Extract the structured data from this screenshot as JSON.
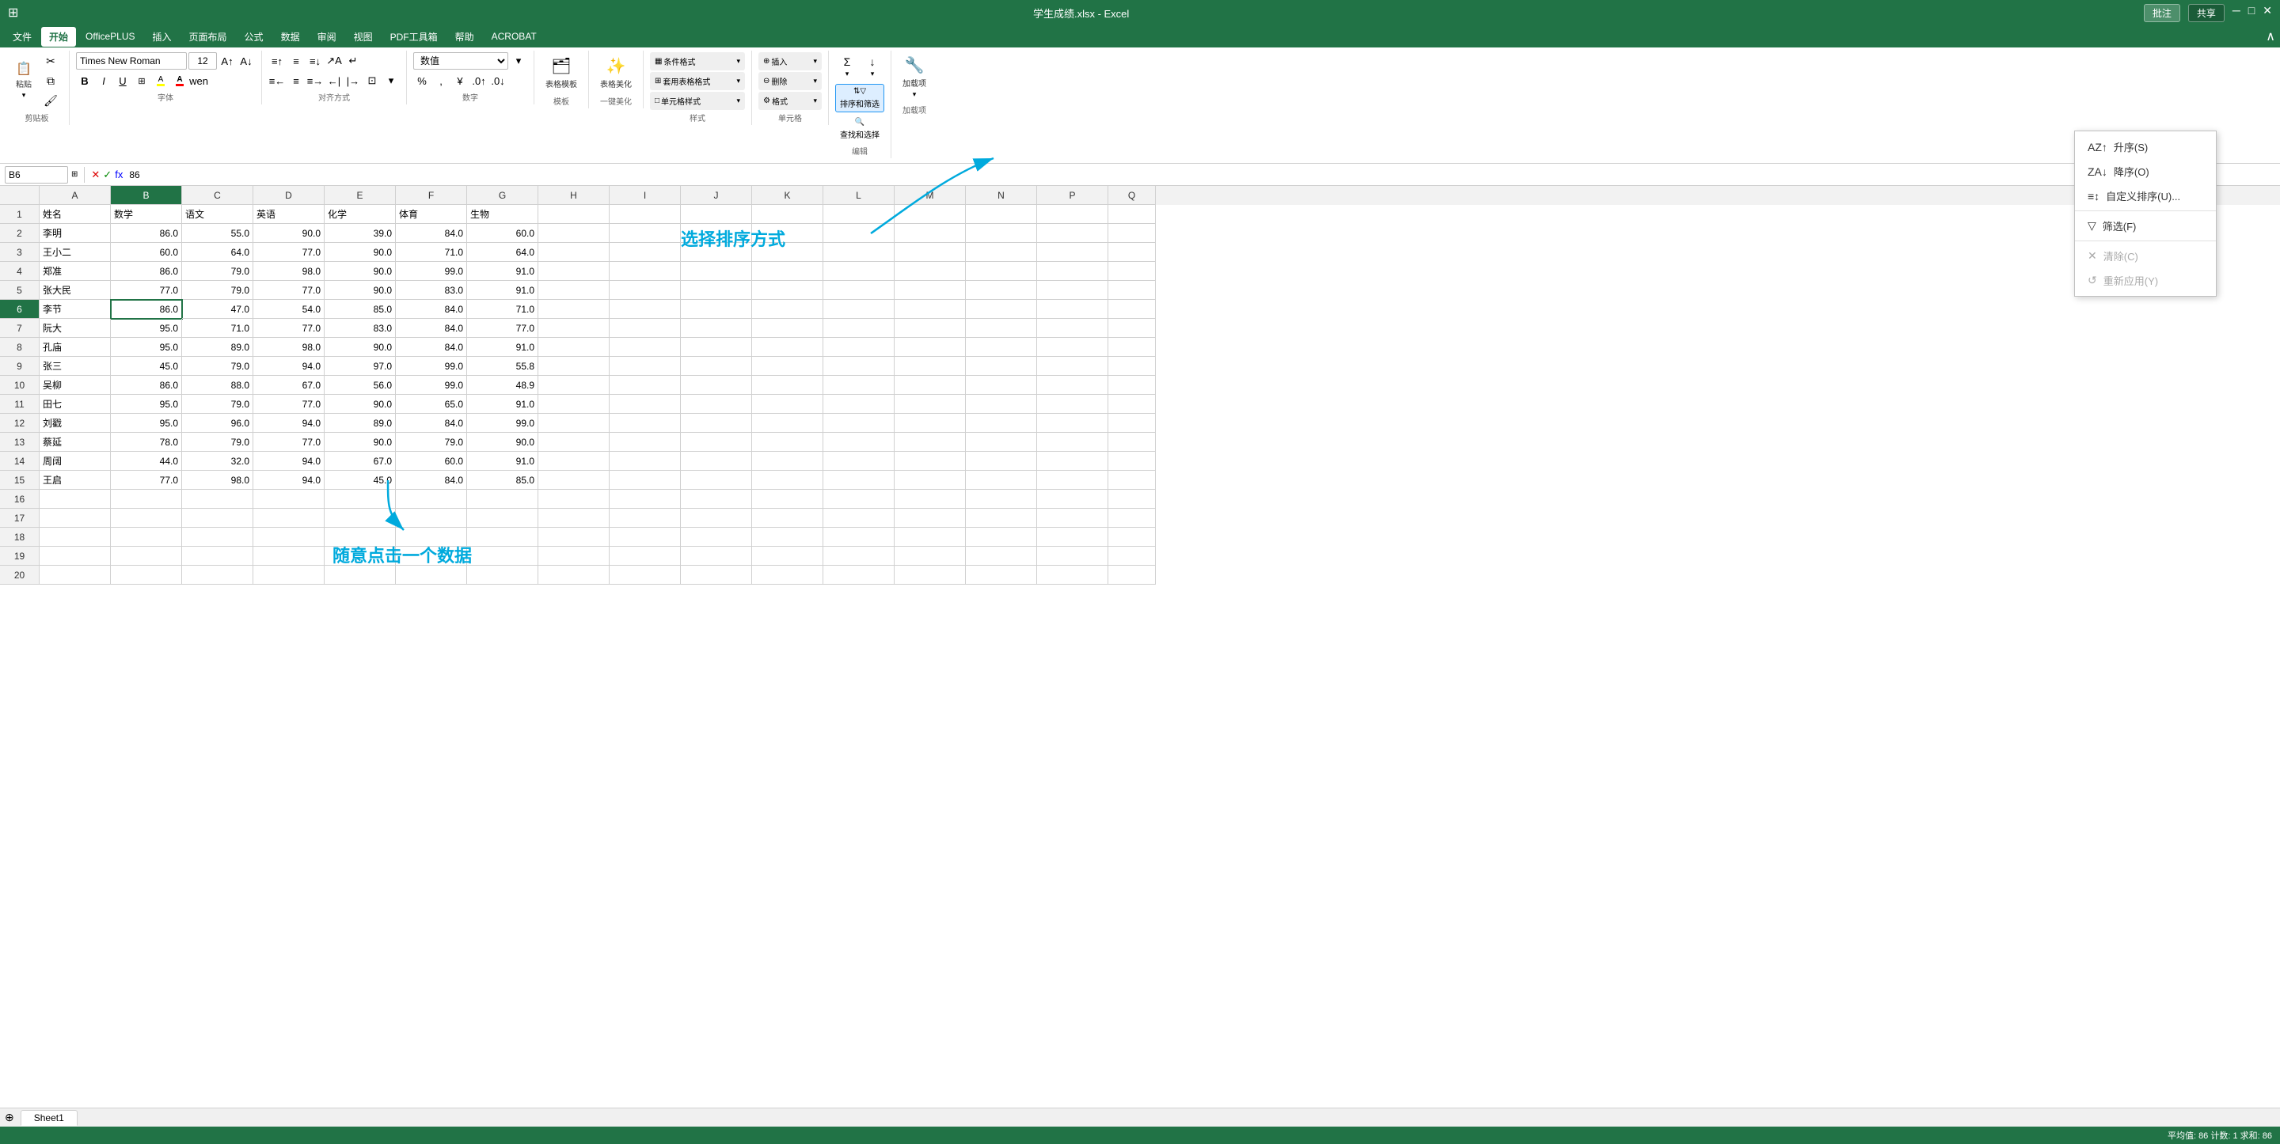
{
  "titleBar": {
    "filename": "学生成绩.xlsx - Excel",
    "commentBtn": "批注",
    "shareBtn": "共享"
  },
  "menuBar": {
    "items": [
      "文件",
      "开始",
      "OfficePLUS",
      "插入",
      "页面布局",
      "公式",
      "数据",
      "审阅",
      "视图",
      "PDF工具箱",
      "帮助",
      "ACROBAT"
    ]
  },
  "ribbon": {
    "groups": {
      "clipboard": {
        "label": "剪贴板",
        "paste": "粘贴",
        "cut": "✂",
        "copy": "⧉",
        "formatPainter": "🖌"
      },
      "font": {
        "label": "字体",
        "fontName": "Times New Roman",
        "fontSize": "12",
        "bold": "B",
        "italic": "I",
        "underline": "U",
        "border": "⊞",
        "fillColor": "🎨",
        "fontColor": "A"
      },
      "alignment": {
        "label": "对齐方式",
        "wrap": "↵"
      },
      "number": {
        "label": "数字",
        "format": "数值"
      },
      "template": {
        "label": "模板",
        "tableTemplate": "表格模板"
      },
      "beauty": {
        "label": "一键美化",
        "tableBeauty": "表格美化"
      },
      "style": {
        "label": "样式",
        "condFormat": "条件格式",
        "tableFormat": "套用表格格式",
        "cellStyle": "单元格样式"
      },
      "cells": {
        "label": "单元格",
        "insert": "插入",
        "delete": "删除",
        "format": "格式"
      },
      "editing": {
        "label": "编辑",
        "sum": "Σ",
        "sortFilter": "排序和筛选",
        "findSelect": "查找和选择"
      },
      "addins": {
        "label": "加载项",
        "addins": "加载项"
      }
    }
  },
  "formulaBar": {
    "cellRef": "B6",
    "value": "86"
  },
  "spreadsheet": {
    "columns": [
      "A",
      "B",
      "C",
      "D",
      "E",
      "F",
      "G",
      "H",
      "I",
      "J",
      "K",
      "L",
      "M",
      "N",
      "P",
      "Q"
    ],
    "headers": [
      "姓名",
      "数学",
      "语文",
      "英语",
      "化学",
      "体育",
      "生物",
      "",
      "",
      "",
      "",
      "",
      "",
      "",
      "",
      ""
    ],
    "rows": [
      {
        "num": 2,
        "cells": [
          "李明",
          "86.0",
          "55.0",
          "90.0",
          "39.0",
          "84.0",
          "60.0",
          "",
          "",
          "",
          "",
          "",
          "",
          "",
          "",
          ""
        ]
      },
      {
        "num": 3,
        "cells": [
          "王小二",
          "60.0",
          "64.0",
          "77.0",
          "90.0",
          "71.0",
          "64.0",
          "",
          "",
          "",
          "",
          "",
          "",
          "",
          "",
          ""
        ]
      },
      {
        "num": 4,
        "cells": [
          "郑准",
          "86.0",
          "79.0",
          "98.0",
          "90.0",
          "99.0",
          "91.0",
          "",
          "",
          "",
          "",
          "",
          "",
          "",
          "",
          ""
        ]
      },
      {
        "num": 5,
        "cells": [
          "张大民",
          "77.0",
          "79.0",
          "77.0",
          "90.0",
          "83.0",
          "91.0",
          "",
          "",
          "",
          "",
          "",
          "",
          "",
          "",
          ""
        ]
      },
      {
        "num": 6,
        "cells": [
          "李节",
          "86.0",
          "47.0",
          "54.0",
          "85.0",
          "84.0",
          "71.0",
          "",
          "",
          "",
          "",
          "",
          "",
          "",
          "",
          ""
        ]
      },
      {
        "num": 7,
        "cells": [
          "阮大",
          "95.0",
          "71.0",
          "77.0",
          "83.0",
          "84.0",
          "77.0",
          "",
          "",
          "",
          "",
          "",
          "",
          "",
          "",
          ""
        ]
      },
      {
        "num": 8,
        "cells": [
          "孔庙",
          "95.0",
          "89.0",
          "98.0",
          "90.0",
          "84.0",
          "91.0",
          "",
          "",
          "",
          "",
          "",
          "",
          "",
          "",
          ""
        ]
      },
      {
        "num": 9,
        "cells": [
          "张三",
          "45.0",
          "79.0",
          "94.0",
          "97.0",
          "99.0",
          "55.8",
          "",
          "",
          "",
          "",
          "",
          "",
          "",
          "",
          ""
        ]
      },
      {
        "num": 10,
        "cells": [
          "吴柳",
          "86.0",
          "88.0",
          "67.0",
          "56.0",
          "99.0",
          "48.9",
          "",
          "",
          "",
          "",
          "",
          "",
          "",
          "",
          ""
        ]
      },
      {
        "num": 11,
        "cells": [
          "田七",
          "95.0",
          "79.0",
          "77.0",
          "90.0",
          "65.0",
          "91.0",
          "",
          "",
          "",
          "",
          "",
          "",
          "",
          "",
          ""
        ]
      },
      {
        "num": 12,
        "cells": [
          "刘戳",
          "95.0",
          "96.0",
          "94.0",
          "89.0",
          "84.0",
          "99.0",
          "",
          "",
          "",
          "",
          "",
          "",
          "",
          "",
          ""
        ]
      },
      {
        "num": 13,
        "cells": [
          "蔡延",
          "78.0",
          "79.0",
          "77.0",
          "90.0",
          "79.0",
          "90.0",
          "",
          "",
          "",
          "",
          "",
          "",
          "",
          "",
          ""
        ]
      },
      {
        "num": 14,
        "cells": [
          "周阔",
          "44.0",
          "32.0",
          "94.0",
          "67.0",
          "60.0",
          "91.0",
          "",
          "",
          "",
          "",
          "",
          "",
          "",
          "",
          ""
        ]
      },
      {
        "num": 15,
        "cells": [
          "王启",
          "77.0",
          "98.0",
          "94.0",
          "45.0",
          "84.0",
          "85.0",
          "",
          "",
          "",
          "",
          "",
          "",
          "",
          "",
          ""
        ]
      },
      {
        "num": 16,
        "cells": [
          "",
          "",
          "",
          "",
          "",
          "",
          "",
          "",
          "",
          "",
          "",
          "",
          "",
          "",
          "",
          ""
        ]
      },
      {
        "num": 17,
        "cells": [
          "",
          "",
          "",
          "",
          "",
          "",
          "",
          "",
          "",
          "",
          "",
          "",
          "",
          "",
          "",
          ""
        ]
      },
      {
        "num": 18,
        "cells": [
          "",
          "",
          "",
          "",
          "",
          "",
          "",
          "",
          "",
          "",
          "",
          "",
          "",
          "",
          "",
          ""
        ]
      },
      {
        "num": 19,
        "cells": [
          "",
          "",
          "",
          "",
          "",
          "",
          "",
          "",
          "",
          "",
          "",
          "",
          "",
          "",
          "",
          ""
        ]
      },
      {
        "num": 20,
        "cells": [
          "",
          "",
          "",
          "",
          "",
          "",
          "",
          "",
          "",
          "",
          "",
          "",
          "",
          "",
          "",
          ""
        ]
      }
    ],
    "activeCell": "B6",
    "activeRow": 6,
    "activeCol": "B"
  },
  "sortDropdown": {
    "title": "排序和筛选",
    "items": [
      {
        "id": "ascending",
        "label": "升序(S)",
        "icon": "AZ↑",
        "disabled": false
      },
      {
        "id": "descending",
        "label": "降序(O)",
        "icon": "ZA↓",
        "disabled": false
      },
      {
        "id": "custom",
        "label": "自定义排序(U)...",
        "icon": "≡↕",
        "disabled": false
      },
      {
        "separator": true
      },
      {
        "id": "filter",
        "label": "筛选(F)",
        "icon": "▽",
        "disabled": false
      },
      {
        "separator": true
      },
      {
        "id": "clear",
        "label": "清除(C)",
        "icon": "✕",
        "disabled": true
      },
      {
        "id": "reapply",
        "label": "重新应用(Y)",
        "icon": "↺",
        "disabled": true
      }
    ]
  },
  "annotations": {
    "sortText": "选择排序方式",
    "clickText": "随意点击一个数据"
  },
  "sheets": [
    "Sheet1"
  ],
  "statusBar": {
    "left": "",
    "right": "平均值: 86  计数: 1  求和: 86"
  }
}
